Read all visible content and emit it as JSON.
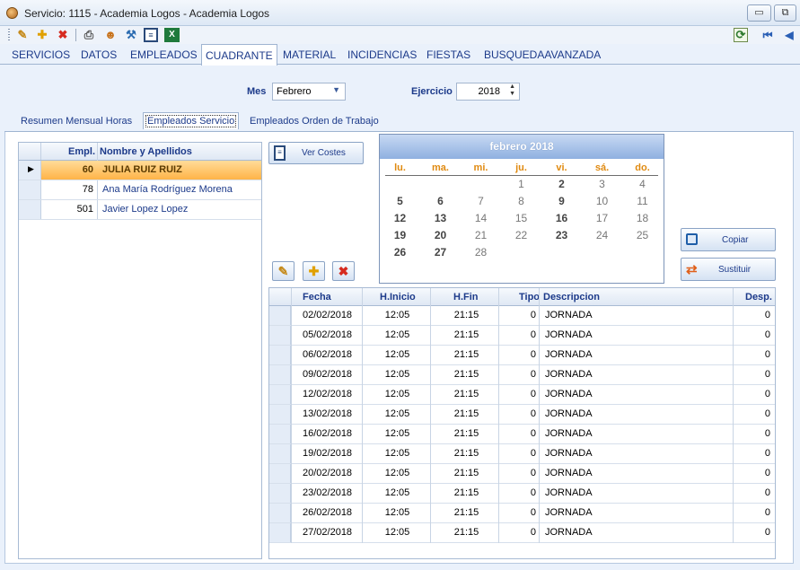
{
  "window": {
    "title": "Servicio: 1115 - Academia Logos - Academia Logos",
    "controls": [
      "▭",
      "⧉"
    ]
  },
  "toolbar": {
    "icons": [
      "edit-icon",
      "add-icon",
      "delete-icon",
      "print-icon",
      "user-icon",
      "worker-icon",
      "document-icon",
      "excel-icon",
      "refresh-icon",
      "first-record-icon",
      "previous-record-icon"
    ]
  },
  "nav": {
    "tabs": [
      "SERVICIOS",
      "DATOS",
      "EMPLEADOS",
      "CUADRANTE",
      "MATERIAL",
      "INCIDENCIAS",
      "FIESTAS",
      "BUSQUEDAAVANZADA"
    ],
    "active": "CUADRANTE"
  },
  "filters": {
    "mes_label": "Mes",
    "mes_value": "Febrero",
    "ejercicio_label": "Ejercicio",
    "ejercicio_value": "2018"
  },
  "subtabs": {
    "items": [
      "Resumen Mensual Horas",
      "Empleados Servicio",
      "Empleados Orden de Trabajo"
    ],
    "active": "Empleados Servicio"
  },
  "employees": {
    "headers": [
      "Empl.",
      "Nombre y Apellidos"
    ],
    "rows": [
      {
        "id": "60",
        "name": "JULIA RUIZ RUIZ"
      },
      {
        "id": "78",
        "name": "Ana María Rodríguez Morena"
      },
      {
        "id": "501",
        "name": "Javier Lopez Lopez"
      }
    ],
    "selected_index": 0
  },
  "buttons": {
    "ver_costes": "Ver Costes",
    "copiar": "Copiar",
    "sustituir": "Sustituir"
  },
  "calendar": {
    "title": "febrero 2018",
    "weekdays": [
      "lu.",
      "ma.",
      "mi.",
      "ju.",
      "vi.",
      "sá.",
      "do."
    ],
    "weeks": [
      [
        "",
        "",
        "",
        "1",
        "2",
        "3",
        "4"
      ],
      [
        "5",
        "6",
        "7",
        "8",
        "9",
        "10",
        "11"
      ],
      [
        "12",
        "13",
        "14",
        "15",
        "16",
        "17",
        "18"
      ],
      [
        "19",
        "20",
        "21",
        "22",
        "23",
        "24",
        "25"
      ],
      [
        "26",
        "27",
        "28",
        "",
        "",
        "",
        ""
      ]
    ],
    "bold_days": [
      "2",
      "5",
      "6",
      "9",
      "12",
      "13",
      "16",
      "19",
      "20",
      "23",
      "26",
      "27"
    ]
  },
  "schedule": {
    "headers": [
      "Fecha",
      "H.Inicio",
      "H.Fin",
      "Tipo",
      "Descripcion",
      "Desp."
    ],
    "rows": [
      {
        "fecha": "02/02/2018",
        "inicio": "12:05",
        "fin": "21:15",
        "tipo": "0",
        "descripcion": "JORNADA",
        "desp": "0"
      },
      {
        "fecha": "05/02/2018",
        "inicio": "12:05",
        "fin": "21:15",
        "tipo": "0",
        "descripcion": "JORNADA",
        "desp": "0"
      },
      {
        "fecha": "06/02/2018",
        "inicio": "12:05",
        "fin": "21:15",
        "tipo": "0",
        "descripcion": "JORNADA",
        "desp": "0"
      },
      {
        "fecha": "09/02/2018",
        "inicio": "12:05",
        "fin": "21:15",
        "tipo": "0",
        "descripcion": "JORNADA",
        "desp": "0"
      },
      {
        "fecha": "12/02/2018",
        "inicio": "12:05",
        "fin": "21:15",
        "tipo": "0",
        "descripcion": "JORNADA",
        "desp": "0"
      },
      {
        "fecha": "13/02/2018",
        "inicio": "12:05",
        "fin": "21:15",
        "tipo": "0",
        "descripcion": "JORNADA",
        "desp": "0"
      },
      {
        "fecha": "16/02/2018",
        "inicio": "12:05",
        "fin": "21:15",
        "tipo": "0",
        "descripcion": "JORNADA",
        "desp": "0"
      },
      {
        "fecha": "19/02/2018",
        "inicio": "12:05",
        "fin": "21:15",
        "tipo": "0",
        "descripcion": "JORNADA",
        "desp": "0"
      },
      {
        "fecha": "20/02/2018",
        "inicio": "12:05",
        "fin": "21:15",
        "tipo": "0",
        "descripcion": "JORNADA",
        "desp": "0"
      },
      {
        "fecha": "23/02/2018",
        "inicio": "12:05",
        "fin": "21:15",
        "tipo": "0",
        "descripcion": "JORNADA",
        "desp": "0"
      },
      {
        "fecha": "26/02/2018",
        "inicio": "12:05",
        "fin": "21:15",
        "tipo": "0",
        "descripcion": "JORNADA",
        "desp": "0"
      },
      {
        "fecha": "27/02/2018",
        "inicio": "12:05",
        "fin": "21:15",
        "tipo": "0",
        "descripcion": "JORNADA",
        "desp": "0"
      }
    ]
  },
  "colors": {
    "accent": "#1c3a8a",
    "selected_row": "#ffc66e",
    "weekday_header": "#e08a10",
    "calendar_header": "#8fb0e0"
  }
}
